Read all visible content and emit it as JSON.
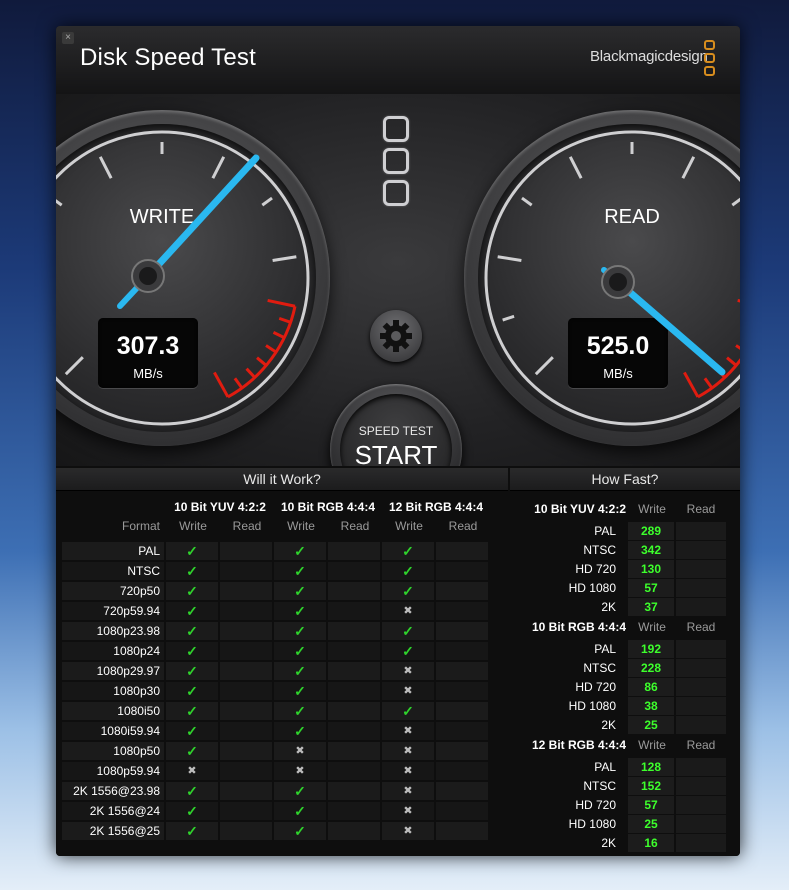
{
  "window": {
    "title": "Disk Speed Test",
    "brand": "Blackmagicdesign",
    "close_glyph": "×"
  },
  "gauges": {
    "write": {
      "label": "WRITE",
      "value": "307.3",
      "unit": "MB/s"
    },
    "read": {
      "label": "READ",
      "value": "525.0",
      "unit": "MB/s"
    }
  },
  "controls": {
    "settings_icon": "gear-icon",
    "start_top": "SPEED TEST",
    "start_main": "START"
  },
  "will_it_work": {
    "heading": "Will it Work?",
    "format_label": "Format",
    "groups": [
      "10 Bit YUV 4:2:2",
      "10 Bit RGB 4:4:4",
      "12 Bit RGB 4:4:4"
    ],
    "subheaders": [
      "Write",
      "Read"
    ],
    "rows": [
      {
        "format": "PAL",
        "w": [
          "check",
          "check",
          "check"
        ]
      },
      {
        "format": "NTSC",
        "w": [
          "check",
          "check",
          "check"
        ]
      },
      {
        "format": "720p50",
        "w": [
          "check",
          "check",
          "check"
        ]
      },
      {
        "format": "720p59.94",
        "w": [
          "check",
          "check",
          "cross"
        ]
      },
      {
        "format": "1080p23.98",
        "w": [
          "check",
          "check",
          "check"
        ]
      },
      {
        "format": "1080p24",
        "w": [
          "check",
          "check",
          "check"
        ]
      },
      {
        "format": "1080p29.97",
        "w": [
          "check",
          "check",
          "cross"
        ]
      },
      {
        "format": "1080p30",
        "w": [
          "check",
          "check",
          "cross"
        ]
      },
      {
        "format": "1080i50",
        "w": [
          "check",
          "check",
          "check"
        ]
      },
      {
        "format": "1080i59.94",
        "w": [
          "check",
          "check",
          "cross"
        ]
      },
      {
        "format": "1080p50",
        "w": [
          "check",
          "cross",
          "cross"
        ]
      },
      {
        "format": "1080p59.94",
        "w": [
          "cross",
          "cross",
          "cross"
        ]
      },
      {
        "format": "2K 1556@23.98",
        "w": [
          "check",
          "check",
          "cross"
        ]
      },
      {
        "format": "2K 1556@24",
        "w": [
          "check",
          "check",
          "cross"
        ]
      },
      {
        "format": "2K 1556@25",
        "w": [
          "check",
          "check",
          "cross"
        ]
      }
    ],
    "symbols": {
      "check": "✓",
      "cross": "✖"
    }
  },
  "how_fast": {
    "heading": "How Fast?",
    "sections": [
      {
        "name": "10 Bit YUV 4:2:2",
        "write_label": "Write",
        "read_label": "Read",
        "rows": [
          {
            "label": "PAL",
            "value": "289"
          },
          {
            "label": "NTSC",
            "value": "342"
          },
          {
            "label": "HD 720",
            "value": "130"
          },
          {
            "label": "HD 1080",
            "value": "57"
          },
          {
            "label": "2K",
            "value": "37"
          }
        ]
      },
      {
        "name": "10 Bit RGB 4:4:4",
        "write_label": "Write",
        "read_label": "Read",
        "rows": [
          {
            "label": "PAL",
            "value": "192"
          },
          {
            "label": "NTSC",
            "value": "228"
          },
          {
            "label": "HD 720",
            "value": "86"
          },
          {
            "label": "HD 1080",
            "value": "38"
          },
          {
            "label": "2K",
            "value": "25"
          }
        ]
      },
      {
        "name": "12 Bit RGB 4:4:4",
        "write_label": "Write",
        "read_label": "Read",
        "rows": [
          {
            "label": "PAL",
            "value": "128"
          },
          {
            "label": "NTSC",
            "value": "152"
          },
          {
            "label": "HD 720",
            "value": "57"
          },
          {
            "label": "HD 1080",
            "value": "25"
          },
          {
            "label": "2K",
            "value": "16"
          }
        ]
      }
    ]
  },
  "colors": {
    "accent_orange": "#d78d1e",
    "needle": "#2ab8f0",
    "good_value": "#3dff2c",
    "redline": "#e01c10"
  }
}
